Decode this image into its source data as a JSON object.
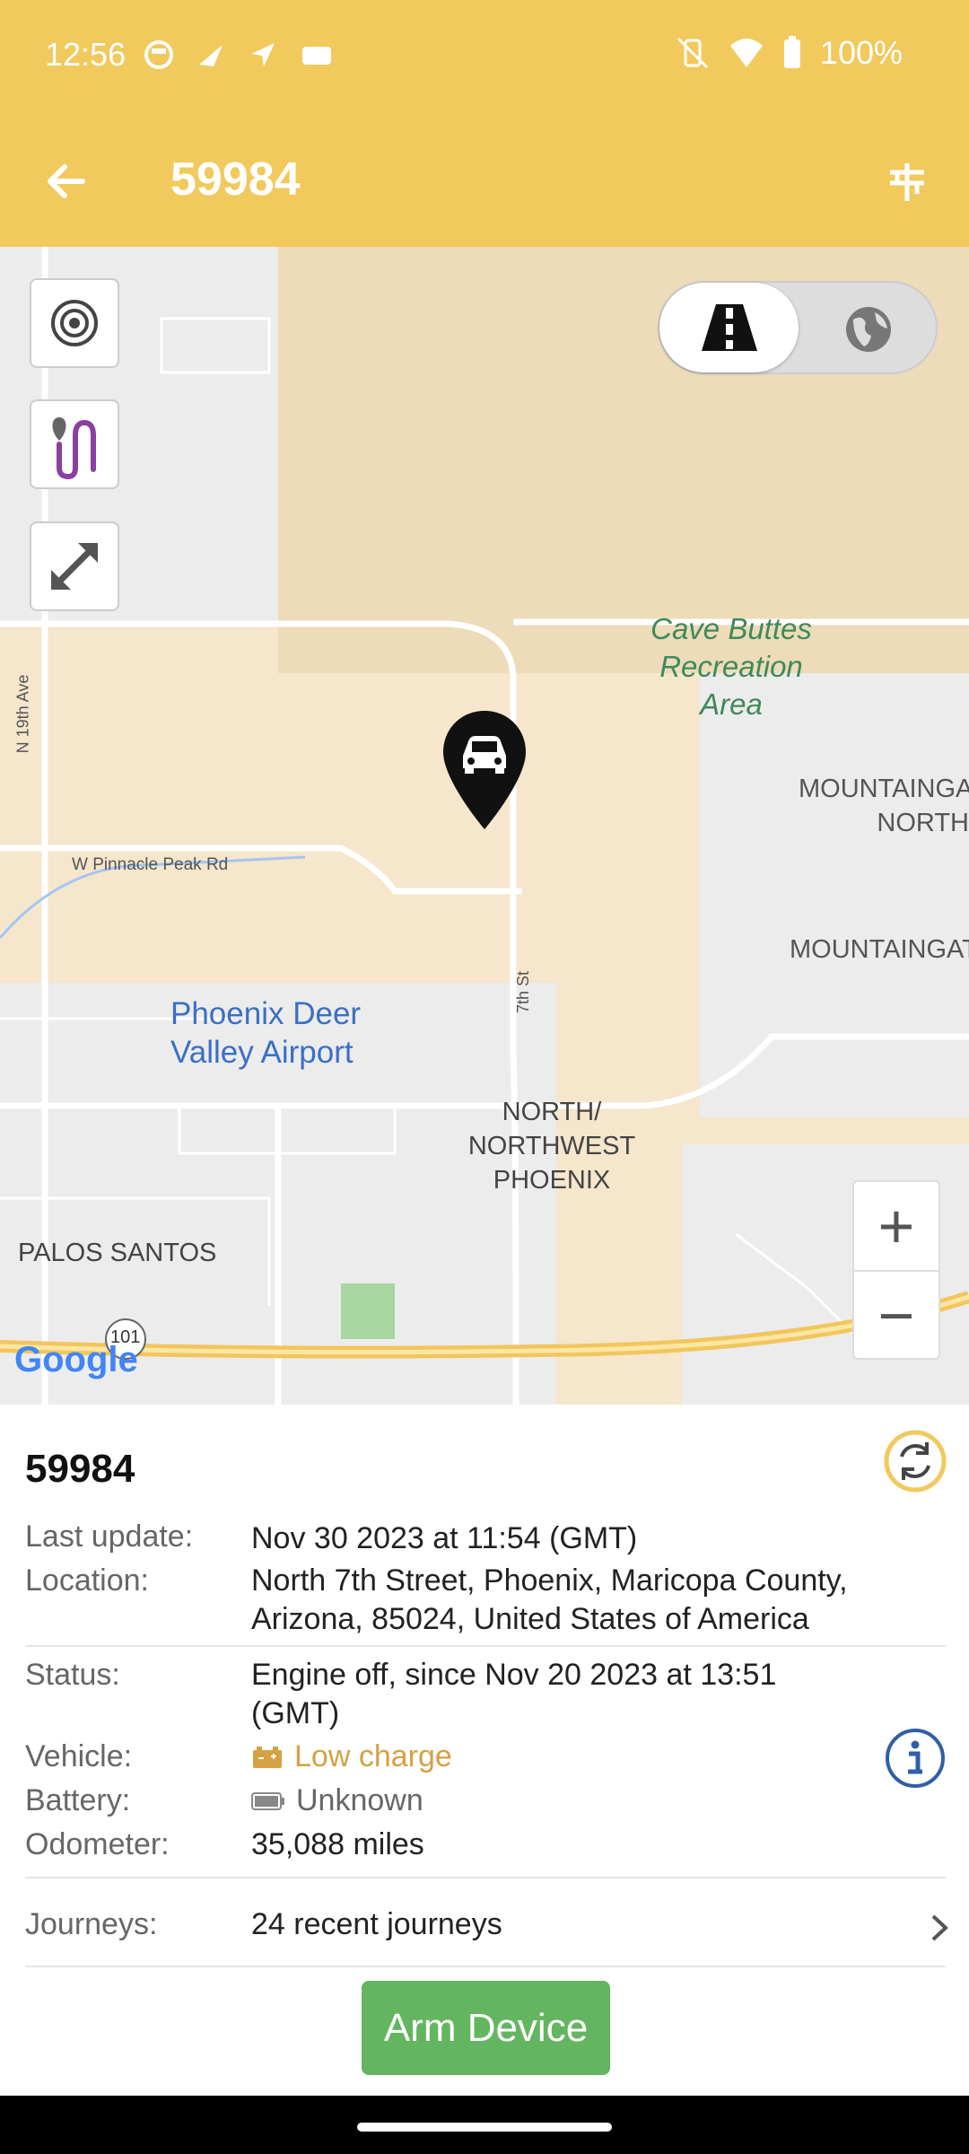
{
  "status_bar": {
    "time": "12:56",
    "battery": "100%"
  },
  "toolbar": {
    "title": "59984"
  },
  "map": {
    "labels": {
      "cave_buttes": "Cave Buttes Recreation Area",
      "mountaingate_north": "MOUNTAINGA NORTH",
      "mountaingate": "MOUNTAINGAT",
      "n19th": "N 19th Ave",
      "pinnacle": "W Pinnacle Peak Rd",
      "seventh": "7th St",
      "airport": "Phoenix Deer Valley Airport",
      "north_nw": "NORTH/ NORTHWEST PHOENIX",
      "palos": "PALOS SANTOS",
      "hwy": "101",
      "google": "Google"
    },
    "zoom_in": "+",
    "zoom_out": "−"
  },
  "panel": {
    "title": "59984",
    "last_update_label": "Last update:",
    "last_update_value": "Nov 30 2023 at 11:54 (GMT)",
    "location_label": "Location:",
    "location_value": "North 7th Street, Phoenix, Maricopa County, Arizona, 85024, United States of America",
    "status_label": "Status:",
    "status_value": "Engine off, since Nov 20 2023 at 13:51 (GMT)",
    "vehicle_label": "Vehicle:",
    "vehicle_value": "Low charge",
    "battery_label": "Battery:",
    "battery_value": "Unknown",
    "odometer_label": "Odometer:",
    "odometer_value": "35,088 miles",
    "journeys_label": "Journeys:",
    "journeys_value": "24 recent journeys",
    "arm_button": "Arm Device"
  },
  "colors": {
    "brand": "#f1c95c",
    "warning": "#d4a143",
    "arm": "#64b55f",
    "info": "#2f5fa8"
  }
}
